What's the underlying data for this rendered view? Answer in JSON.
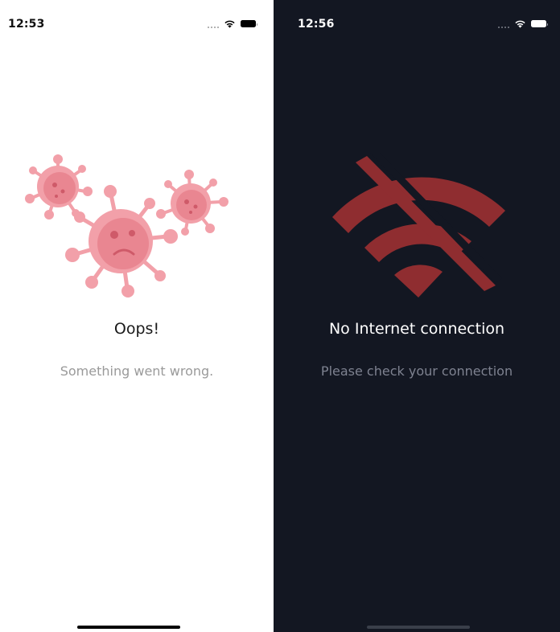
{
  "screens": {
    "error": {
      "status_time": "12:53",
      "title": "Oops!",
      "message": "Something went wrong.",
      "illustration_icon": "virus-icon",
      "colors": {
        "background": "#ffffff",
        "virus_main": "#f2a0a9",
        "virus_body": "#e98691",
        "virus_dark": "#cf5a69"
      }
    },
    "offline": {
      "status_time": "12:56",
      "title": "No Internet connection",
      "message": "Please check your connection",
      "illustration_icon": "wifi-off-icon",
      "colors": {
        "background": "#131722",
        "icon": "#8f2d30"
      }
    }
  }
}
